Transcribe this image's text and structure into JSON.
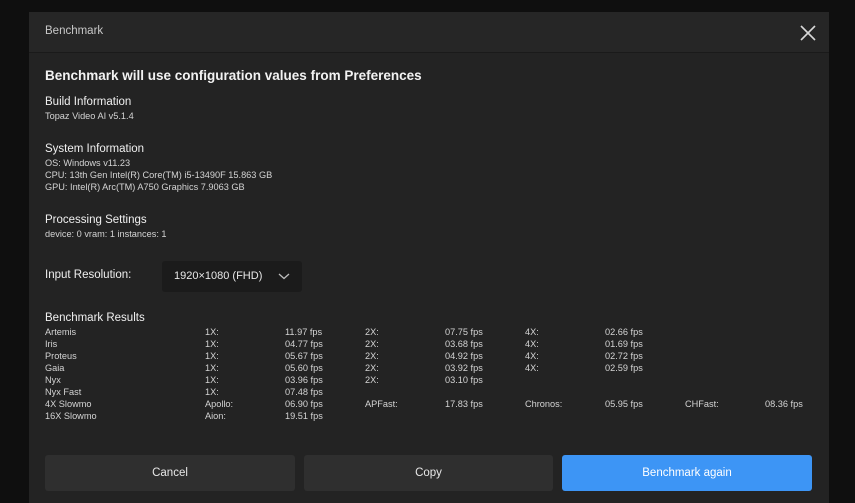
{
  "window": {
    "title": "Benchmark"
  },
  "heading": "Benchmark will use configuration values from Preferences",
  "build": {
    "title": "Build Information",
    "version": "Topaz Video AI v5.1.4"
  },
  "system": {
    "title": "System Information",
    "os": "OS: Windows v11.23",
    "cpu": "CPU: 13th Gen Intel(R) Core(TM) i5-13490F  15.863 GB",
    "gpu": "GPU: Intel(R) Arc(TM) A750 Graphics  7.9063 GB"
  },
  "processing": {
    "title": "Processing Settings",
    "values": "device: 0 vram: 1 instances: 1"
  },
  "input_resolution": {
    "label": "Input Resolution:",
    "selected": "1920×1080 (FHD)"
  },
  "results": {
    "title": "Benchmark Results",
    "rows": [
      {
        "model": "Artemis",
        "c1": "1X:",
        "v1": "11.97 fps",
        "c2": "2X:",
        "v2": "07.75 fps",
        "c3": "4X:",
        "v3": "02.66 fps",
        "c4": "",
        "v4": ""
      },
      {
        "model": "Iris",
        "c1": "1X:",
        "v1": "04.77 fps",
        "c2": "2X:",
        "v2": "03.68 fps",
        "c3": "4X:",
        "v3": "01.69 fps",
        "c4": "",
        "v4": ""
      },
      {
        "model": "Proteus",
        "c1": "1X:",
        "v1": "05.67 fps",
        "c2": "2X:",
        "v2": "04.92 fps",
        "c3": "4X:",
        "v3": "02.72 fps",
        "c4": "",
        "v4": ""
      },
      {
        "model": "Gaia",
        "c1": "1X:",
        "v1": "05.60 fps",
        "c2": "2X:",
        "v2": "03.92 fps",
        "c3": "4X:",
        "v3": "02.59 fps",
        "c4": "",
        "v4": ""
      },
      {
        "model": "Nyx",
        "c1": "1X:",
        "v1": "03.96 fps",
        "c2": "2X:",
        "v2": "03.10 fps",
        "c3": "",
        "v3": "",
        "c4": "",
        "v4": ""
      },
      {
        "model": "Nyx Fast",
        "c1": "1X:",
        "v1": "07.48 fps",
        "c2": "",
        "v2": "",
        "c3": "",
        "v3": "",
        "c4": "",
        "v4": ""
      },
      {
        "model": "4X Slowmo",
        "c1": "Apollo:",
        "v1": "06.90 fps",
        "c2": "APFast:",
        "v2": "17.83 fps",
        "c3": "Chronos:",
        "v3": "05.95 fps",
        "c4": "CHFast:",
        "v4": "08.36 fps"
      },
      {
        "model": "16X Slowmo",
        "c1": "Aion:",
        "v1": "19.51 fps",
        "c2": "",
        "v2": "",
        "c3": "",
        "v3": "",
        "c4": "",
        "v4": ""
      }
    ]
  },
  "buttons": {
    "cancel": "Cancel",
    "copy": "Copy",
    "again": "Benchmark again"
  },
  "colors": {
    "accent": "#3d95f5",
    "dialog_bg": "#232323",
    "button_bg": "#2f2f2f"
  },
  "icons": {
    "close": "close-icon",
    "dropdown": "chevron-down-icon"
  }
}
